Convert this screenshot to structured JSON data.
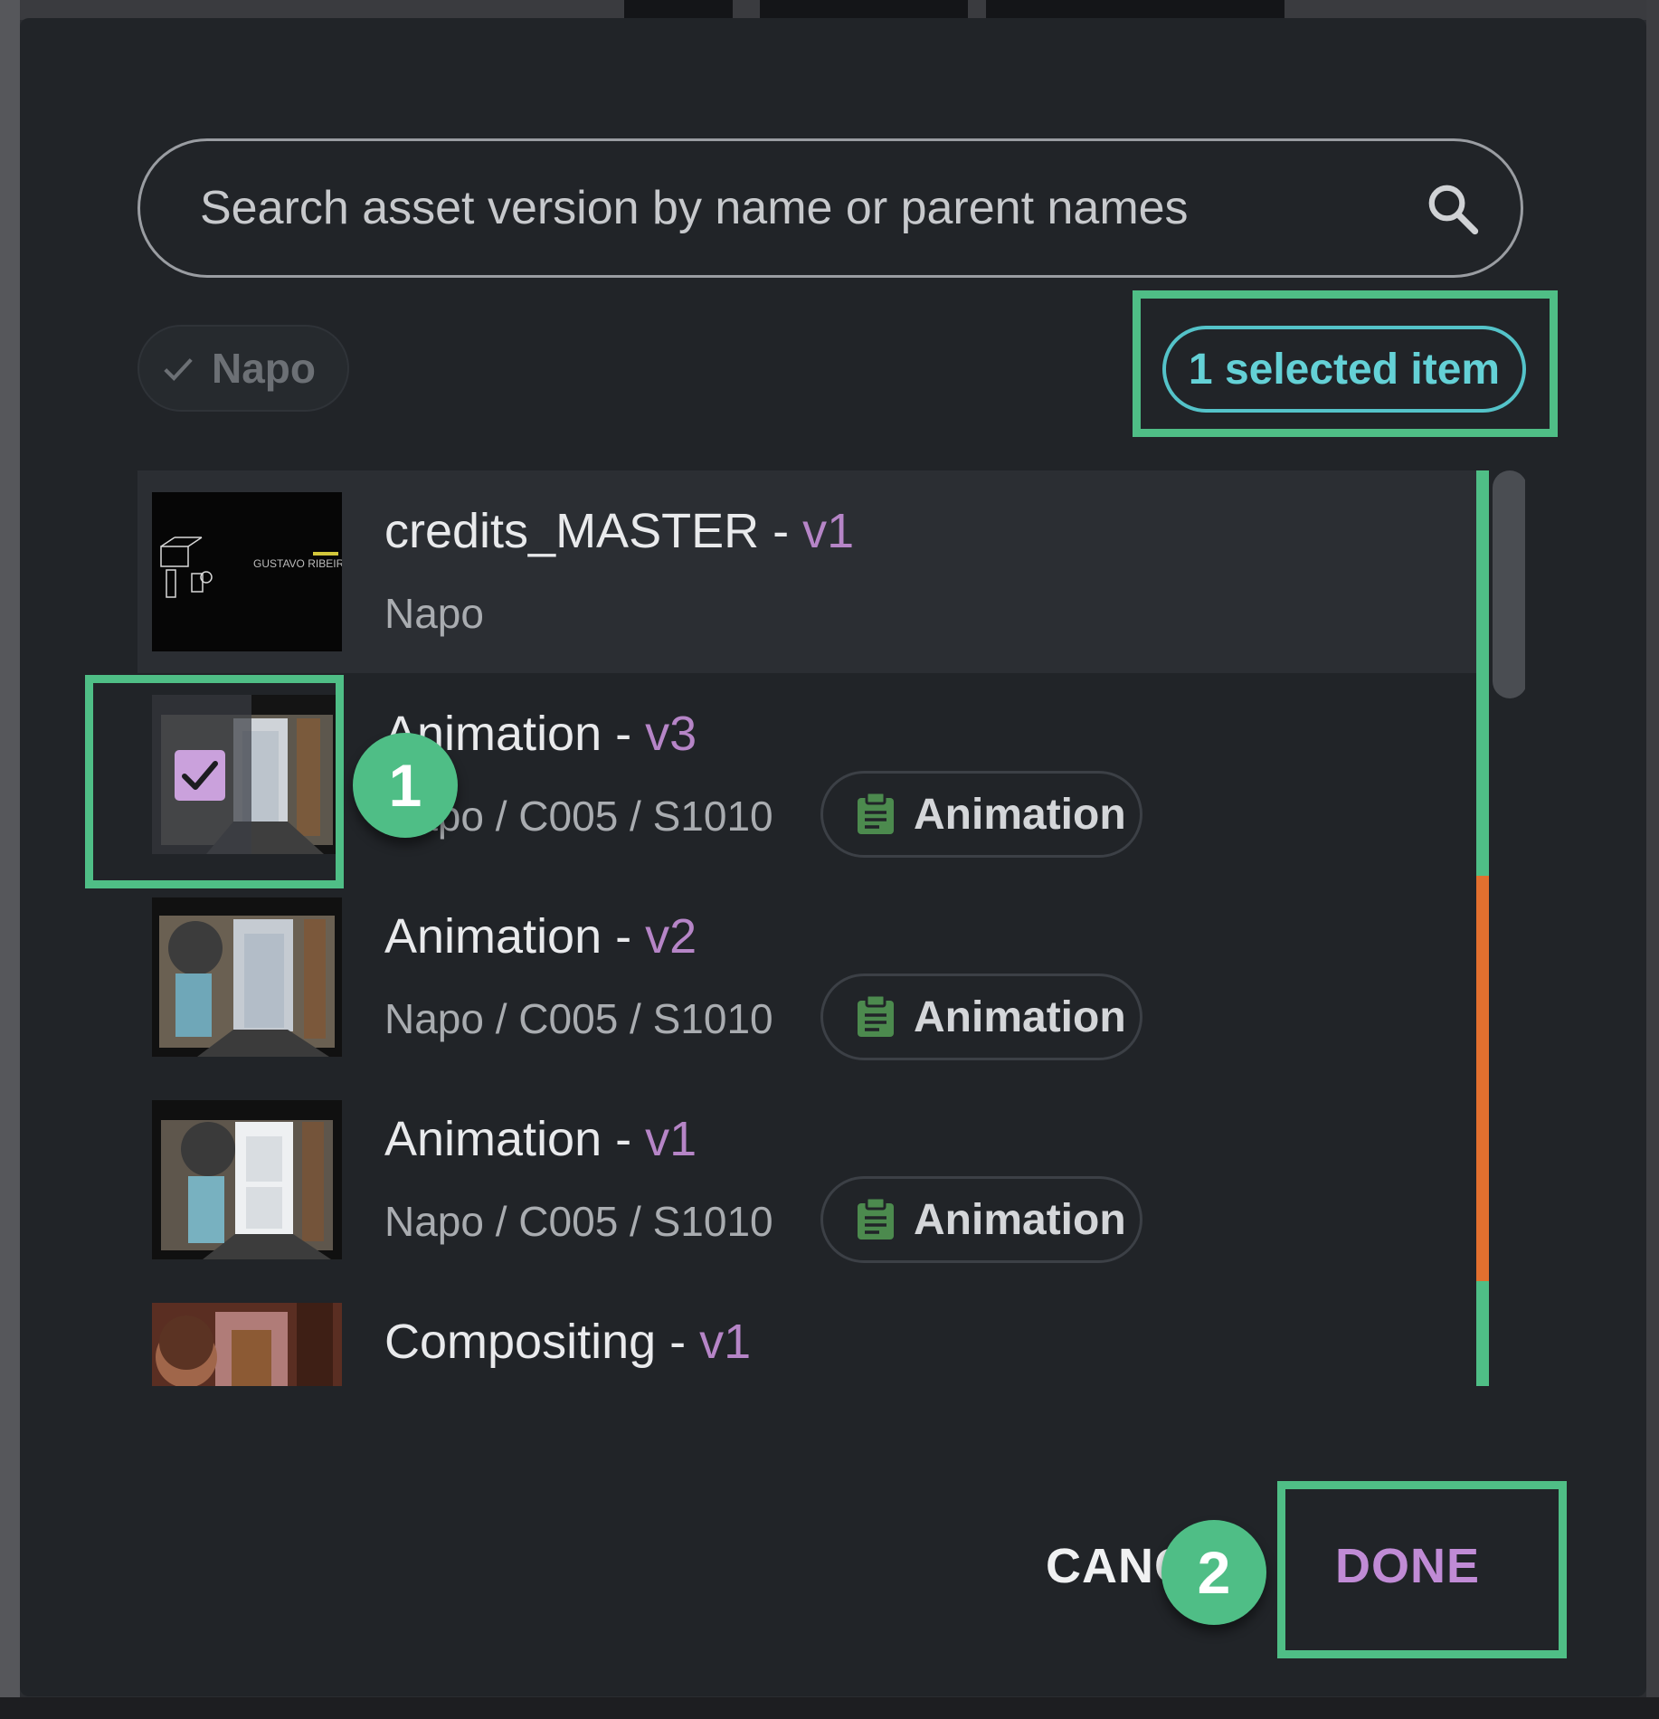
{
  "search": {
    "placeholder": "Search asset version by name or parent names"
  },
  "filter_chip": {
    "label": "Napo",
    "icon": "check-icon"
  },
  "selection": {
    "label": "1 selected item"
  },
  "list": {
    "items": [
      {
        "name": "credits_MASTER",
        "version": "v1",
        "path": "Napo",
        "type": "",
        "thumb_text": "GUSTAVO RIBEIRO",
        "status_color": "#4fbe86",
        "selected": false
      },
      {
        "name": "Animation",
        "version": "v3",
        "path": "Napo / C005 / S1010",
        "type": "Animation",
        "status_color": "#4fbe86",
        "selected": true
      },
      {
        "name": "Animation",
        "version": "v2",
        "path": "Napo / C005 / S1010",
        "type": "Animation",
        "status_color": "#e2702f",
        "selected": false
      },
      {
        "name": "Animation",
        "version": "v1",
        "path": "Napo / C005 / S1010",
        "type": "Animation",
        "status_color": "#e2702f",
        "selected": false
      },
      {
        "name": "Compositing",
        "version": "v1",
        "path": "",
        "type": "",
        "status_color": "#4fbe86",
        "selected": false
      }
    ]
  },
  "annotations": {
    "step1": "1",
    "step2": "2"
  },
  "footer": {
    "cancel_label": "CANCEL",
    "done_label": "DONE"
  },
  "colors": {
    "accent_green": "#4fbe86",
    "accent_teal": "#54c3c9",
    "version_purple": "#b685c7",
    "status_orange": "#e2702f",
    "dialog_bg": "#212428"
  }
}
